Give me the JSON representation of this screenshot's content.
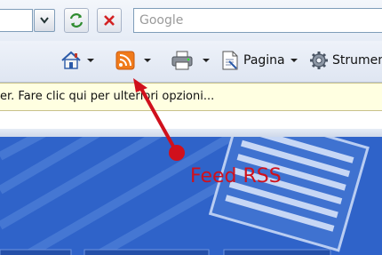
{
  "address_bar": {
    "go_icon": "refresh-arrows-icon",
    "stop_icon": "stop-x-icon"
  },
  "search": {
    "placeholder": "Google"
  },
  "command_bar": {
    "home_icon": "home-icon",
    "feeds_icon": "rss-feed-icon",
    "print_icon": "printer-icon",
    "page_label": "Pagina",
    "tools_label": "Strumenti"
  },
  "info_bar": {
    "text": "er. Fare clic qui per ulteriori opzioni..."
  },
  "annotation": {
    "label": "Feed RSS",
    "color": "#d0101c"
  },
  "colors": {
    "rss_orange": "#f07a1a",
    "page_blue": "#2f63c9",
    "infobar_yellow": "#ffffe1"
  }
}
